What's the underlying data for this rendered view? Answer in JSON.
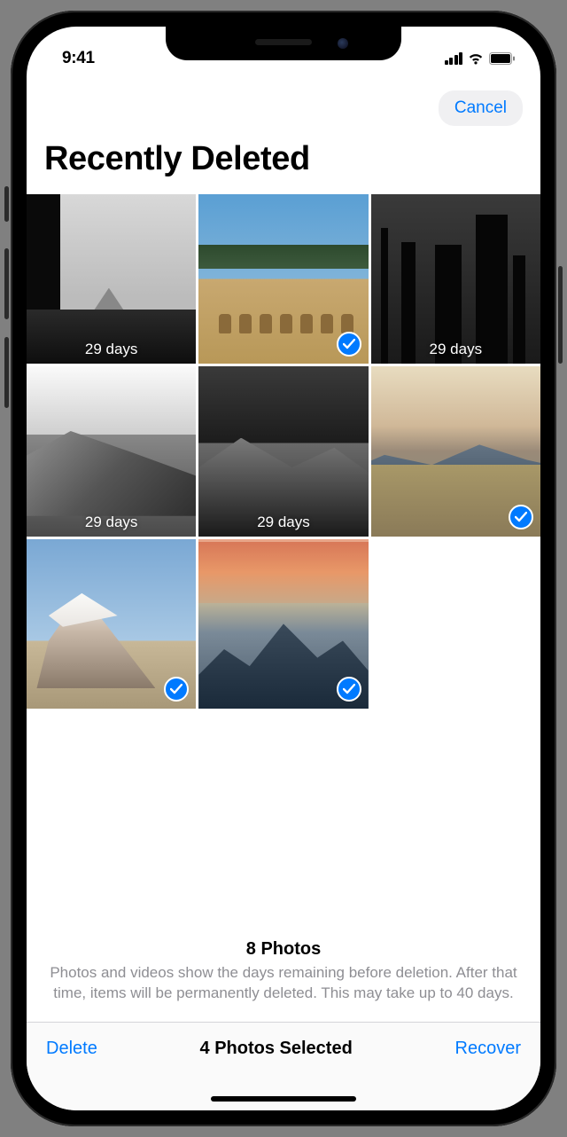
{
  "status_bar": {
    "time": "9:41"
  },
  "nav": {
    "cancel": "Cancel"
  },
  "page": {
    "title": "Recently Deleted"
  },
  "photos": [
    {
      "days_label": "29 days",
      "selected": false
    },
    {
      "days_label": "",
      "selected": true
    },
    {
      "days_label": "29 days",
      "selected": false
    },
    {
      "days_label": "29 days",
      "selected": false
    },
    {
      "days_label": "29 days",
      "selected": false
    },
    {
      "days_label": "",
      "selected": true
    },
    {
      "days_label": "",
      "selected": true
    },
    {
      "days_label": "",
      "selected": true
    }
  ],
  "info": {
    "count": "8 Photos",
    "description": "Photos and videos show the days remaining before deletion. After that time, items will be permanently deleted. This may take up to 40 days."
  },
  "toolbar": {
    "delete": "Delete",
    "selected": "4 Photos Selected",
    "recover": "Recover"
  }
}
